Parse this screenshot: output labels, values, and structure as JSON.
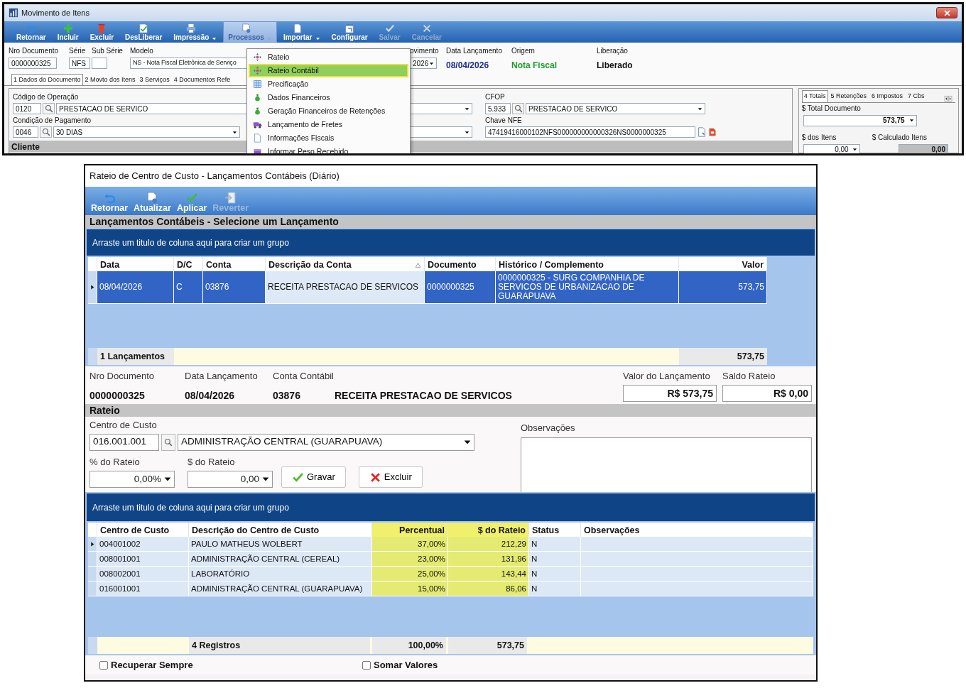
{
  "main_window": {
    "title": "Movimento de Itens",
    "toolbar": [
      {
        "label": "Retornar",
        "dropdown": false,
        "disabled": false,
        "selected": false
      },
      {
        "label": "Incluir",
        "dropdown": false,
        "disabled": false,
        "selected": false
      },
      {
        "label": "Excluir",
        "dropdown": false,
        "disabled": false,
        "selected": false
      },
      {
        "label": "DesLiberar",
        "dropdown": false,
        "disabled": false,
        "selected": false
      },
      {
        "label": "Impressão",
        "dropdown": true,
        "disabled": false,
        "selected": false
      },
      {
        "label": "Processos",
        "dropdown": true,
        "disabled": true,
        "selected": true
      },
      {
        "label": "Importar",
        "dropdown": true,
        "disabled": false,
        "selected": false
      },
      {
        "label": "Configurar",
        "dropdown": false,
        "disabled": false,
        "selected": false
      },
      {
        "label": "Salvar",
        "dropdown": false,
        "disabled": true,
        "selected": false
      },
      {
        "label": "Cancelar",
        "dropdown": false,
        "disabled": true,
        "selected": false
      }
    ],
    "header_fields": [
      {
        "label": "Nro Documento",
        "value": "0000000325",
        "kind": "text"
      },
      {
        "label": "Série",
        "value": "NFS",
        "kind": "text"
      },
      {
        "label": "Sub Série",
        "kind": "text"
      },
      {
        "label": "Modelo",
        "value": "NS - Nota Fiscal Eletrônica de Serviço",
        "kind": "text"
      },
      {
        "label": "ovimento",
        "value": "2026",
        "kind": "select"
      },
      {
        "label": "Data Lançamento",
        "value": "08/04/2026",
        "kind": "display",
        "color": "#1c2f8f"
      },
      {
        "label": "Origem",
        "value": "Nota Fiscal",
        "kind": "display",
        "color": "#1f9a2a"
      },
      {
        "label": "Liberação",
        "value": "Liberado",
        "kind": "display",
        "color": "#111111"
      }
    ],
    "tabs": [
      {
        "label": "1 Dados do Documento",
        "selected": true
      },
      {
        "label": "2 Movto dos Itens",
        "selected": false
      },
      {
        "label": "3 Serviços",
        "selected": false
      },
      {
        "label": "4 Documentos Refe",
        "selected": false
      }
    ],
    "operation": {
      "label": "Código de Operação",
      "code": "0120",
      "text": "PRESTACAO DE SERVICO"
    },
    "payment": {
      "label": "Condição de Pagamento",
      "code": "0046",
      "text": "30 DIAS"
    },
    "cfop": {
      "label": "CFOP",
      "code": "5.933",
      "text": "PRESTACAO DE SERVICO"
    },
    "chave_nfe": {
      "label": "Chave NFE",
      "value": "47419416000102NFS000000000000326NS0000000325"
    },
    "section": "Cliente",
    "totals_panel": {
      "tabs": [
        {
          "label": "4 Totais",
          "selected": true
        },
        {
          "label": "5 Retenções",
          "selected": false
        },
        {
          "label": "6 Impostos",
          "selected": false
        },
        {
          "label": "7 Cbs",
          "selected": false
        }
      ],
      "total_documento": {
        "label": "$ Total Documento",
        "value": "573,75"
      },
      "dos_itens": {
        "label": "$ dos Itens",
        "value": "0,00"
      },
      "calculado_itens": {
        "label": "$ Calculado Itens",
        "value": "0,00"
      }
    },
    "menu": {
      "items": [
        {
          "label": "Rateio",
          "selected": false
        },
        {
          "label": "Rateio Contábil",
          "selected": true
        },
        {
          "label": "Precificação",
          "selected": false
        },
        {
          "label": "Dados Financeiros",
          "selected": false
        },
        {
          "label": "Geração Financeiros de Retenções",
          "selected": false
        },
        {
          "label": "Lançamento de Fretes",
          "selected": false
        },
        {
          "label": "Informações Fiscais",
          "selected": false
        },
        {
          "label": "Informar Peso Recebido",
          "selected": false
        }
      ]
    }
  },
  "dialog": {
    "title": "Rateio de Centro de Custo - Lançamentos Contábeis (Diário)",
    "toolbar": [
      {
        "label": "Retornar",
        "disabled": false
      },
      {
        "label": "Atualizar",
        "disabled": false
      },
      {
        "label": "Aplicar",
        "disabled": false
      },
      {
        "label": "Reverter",
        "disabled": true
      }
    ],
    "section_title": "Lançamentos Contábeis - Selecione um Lançamento",
    "group_hint": "Arraste um titulo de coluna aqui para criar um grupo",
    "grid": {
      "columns": [
        {
          "label": "Data",
          "sorted": false,
          "focused": false
        },
        {
          "label": "D/C",
          "sorted": false,
          "focused": false
        },
        {
          "label": "Conta",
          "sorted": false,
          "focused": false
        },
        {
          "label": "Descrição da Conta",
          "sorted": true,
          "focused": true
        },
        {
          "label": "Documento",
          "sorted": false,
          "focused": false
        },
        {
          "label": "Histórico / Complemento",
          "sorted": false,
          "focused": false
        },
        {
          "label": "Valor",
          "sorted": false,
          "focused": false
        }
      ],
      "rows": [
        {
          "selected": true,
          "cells": [
            "08/04/2026",
            "C",
            "03876",
            "RECEITA PRESTACAO DE SERVICOS",
            "0000000325",
            "0000000325 - SURG COMPANHIA DE SERVICOS DE URBANIZACAO DE GUARAPUAVA",
            "573,75"
          ]
        }
      ],
      "footer": {
        "count": "1 Lançamentos",
        "total": "573,75"
      }
    },
    "info": [
      {
        "label": "Nro Documento",
        "value": "0000000325",
        "kind": "plain"
      },
      {
        "label": "Data Lançamento",
        "value": "08/04/2026",
        "kind": "plain"
      },
      {
        "label": "Conta Contábil",
        "value": "03876",
        "extra": "RECEITA PRESTACAO DE SERVICOS",
        "kind": "plain"
      },
      {
        "label": "Valor do Lançamento",
        "value": "R$ 573,75",
        "kind": "boxed"
      },
      {
        "label": "Saldo Rateio",
        "value": "R$ 0,00",
        "kind": "boxed"
      }
    ],
    "rateio_title": "Rateio",
    "form": {
      "cost_center": {
        "label": "Centro de Custo",
        "code": "016.001.001",
        "name": "ADMINISTRAÇÃO CENTRAL (GUARAPUAVA)"
      },
      "percent": {
        "label": "% do Rateio",
        "value": "0,00%"
      },
      "amount": {
        "label": "$ do Rateio",
        "value": "0,00"
      },
      "buttons": [
        {
          "label": "Gravar"
        },
        {
          "label": "Excluir"
        }
      ],
      "observations": {
        "label": "Observações"
      }
    },
    "group_hint_2": "Arraste um titulo de coluna aqui para criar um grupo",
    "grid_2": {
      "columns": [
        {
          "label": "Centro de Custo",
          "highlighted": false
        },
        {
          "label": "Descrição do Centro de Custo",
          "highlighted": false
        },
        {
          "label": "Percentual",
          "highlighted": true
        },
        {
          "label": "$ do Rateio",
          "highlighted": true
        },
        {
          "label": "Status",
          "highlighted": false
        },
        {
          "label": "Observações",
          "highlighted": false
        }
      ],
      "rows": [
        {
          "selected": true,
          "cells": [
            "004001002",
            "PAULO MATHEUS WOLBERT",
            "37,00%",
            "212,29",
            "N"
          ]
        },
        {
          "selected": false,
          "cells": [
            "008001001",
            "ADMINISTRAÇÃO CENTRAL (CEREAL)",
            "23,00%",
            "131,96",
            "N"
          ]
        },
        {
          "selected": false,
          "cells": [
            "008002001",
            "LABORATÓRIO",
            "25,00%",
            "143,44",
            "N"
          ]
        },
        {
          "selected": false,
          "cells": [
            "016001001",
            "ADMINISTRAÇÃO CENTRAL (GUARAPUAVA)",
            "15,00%",
            "86,06",
            "N"
          ]
        }
      ],
      "footer": {
        "count": "4 Registros",
        "percent": "100,00%",
        "total": "573,75"
      }
    },
    "options": [
      {
        "label": "Recuperar Sempre",
        "checked": false
      },
      {
        "label": "Somar Valores",
        "checked": false
      }
    ]
  }
}
